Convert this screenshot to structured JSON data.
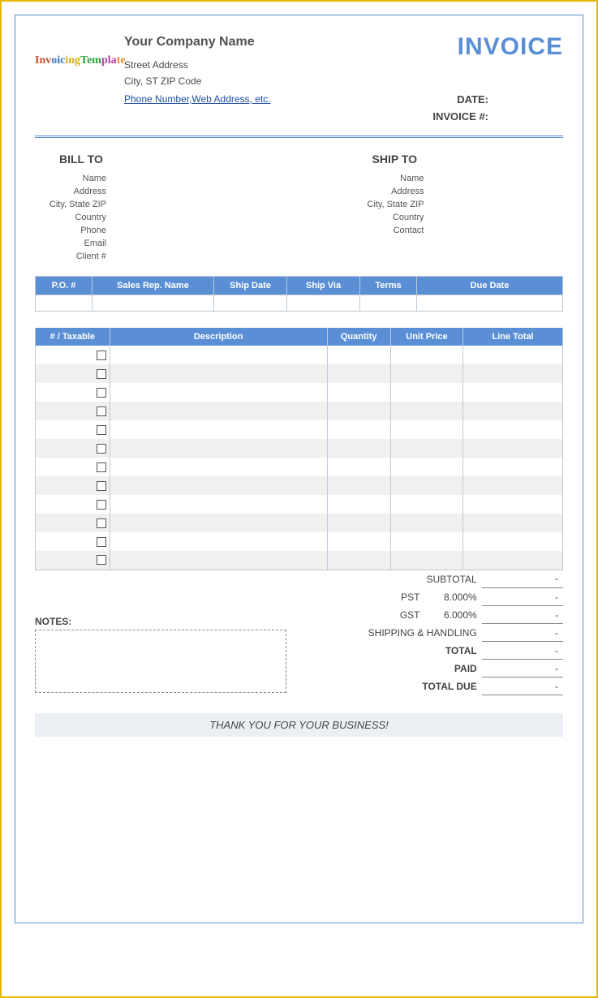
{
  "header": {
    "logo_text": "InvoicingTemplate",
    "company_name": "Your Company Name",
    "street": "Street Address",
    "city_line": "City, ST  ZIP Code",
    "contact_link": "Phone Number,Web Address, etc.",
    "invoice_title": "INVOICE",
    "date_label": "DATE:",
    "invoice_no_label": "INVOICE #:"
  },
  "bill_to": {
    "title": "BILL TO",
    "name": "Name",
    "address": "Address",
    "city": "City, State ZIP",
    "country": "Country",
    "phone": "Phone",
    "email": "Email",
    "client": "Client #"
  },
  "ship_to": {
    "title": "SHIP TO",
    "name": "Name",
    "address": "Address",
    "city": "City, State ZIP",
    "country": "Country",
    "contact": "Contact"
  },
  "order_headers": {
    "po": "P.O. #",
    "rep": "Sales Rep. Name",
    "ship_date": "Ship Date",
    "ship_via": "Ship Via",
    "terms": "Terms",
    "due": "Due Date"
  },
  "line_headers": {
    "tax": "# / Taxable",
    "desc": "Description",
    "qty": "Quantity",
    "price": "Unit Price",
    "total": "Line Total"
  },
  "line_row_count": 12,
  "totals": {
    "subtotal_label": "SUBTOTAL",
    "subtotal_value": "-",
    "pst_label": "PST",
    "pst_rate": "8.000%",
    "pst_value": "-",
    "gst_label": "GST",
    "gst_rate": "6.000%",
    "gst_value": "-",
    "shipping_label": "SHIPPING & HANDLING",
    "shipping_value": "-",
    "total_label": "TOTAL",
    "total_value": "-",
    "paid_label": "PAID",
    "paid_value": "-",
    "due_label": "TOTAL DUE",
    "due_value": "-"
  },
  "notes_label": "NOTES:",
  "thankyou": "THANK YOU FOR YOUR BUSINESS!"
}
